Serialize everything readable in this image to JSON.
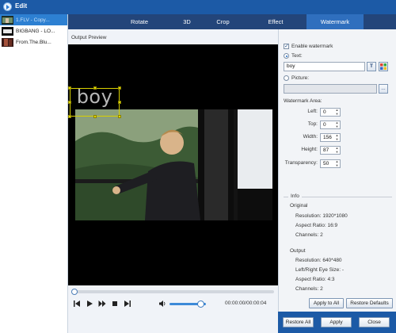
{
  "window": {
    "title": "Edit"
  },
  "file_list": [
    {
      "name": "1.FLV - Copy...",
      "selected": true
    },
    {
      "name": "BIGBANG - LO...",
      "selected": false
    },
    {
      "name": "From.The.Blu...",
      "selected": false
    }
  ],
  "tabs": [
    {
      "label": "Rotate",
      "active": false
    },
    {
      "label": "3D",
      "active": false
    },
    {
      "label": "Crop",
      "active": false
    },
    {
      "label": "Effect",
      "active": false
    },
    {
      "label": "Watermark",
      "active": true
    }
  ],
  "preview": {
    "label": "Output Preview",
    "watermark_text": "boy",
    "time": "00:00:00/00:00:04",
    "seek_fraction": 0,
    "volume_fraction": 0.85
  },
  "watermark": {
    "enable_label": "Enable watermark",
    "enabled": true,
    "text_label": "Text:",
    "text_selected": true,
    "text_value": "boy",
    "picture_label": "Picture:",
    "picture_selected": false,
    "picture_value": "",
    "browse_label": "...",
    "text_btn": "T",
    "area_label": "Watermark Area:",
    "left_label": "Left:",
    "left_value": "0",
    "top_label": "Top:",
    "top_value": "0",
    "width_label": "Width:",
    "width_value": "156",
    "height_label": "Height:",
    "height_value": "87",
    "transparency_label": "Transparency:",
    "transparency_value": "50"
  },
  "info": {
    "title": "Info",
    "original_label": "Original",
    "original_resolution": "Resolution: 1920*1080",
    "original_aspect": "Aspect Ratio: 16:9",
    "original_channels": "Channels: 2",
    "output_label": "Output",
    "output_resolution": "Resolution: 640*480",
    "output_eye": "Left/Right Eye Size: -",
    "output_aspect": "Aspect Ratio: 4:3",
    "output_channels": "Channels: 2"
  },
  "buttons": {
    "apply_to_all": "Apply to All",
    "restore_defaults": "Restore Defaults",
    "restore_all": "Restore All",
    "apply": "Apply",
    "close": "Close"
  },
  "colors": {
    "titlebar": "#1c5aa6",
    "tabbar": "#23457a",
    "active_tab": "#2f6fbe",
    "selected_file": "#2d80d2"
  }
}
